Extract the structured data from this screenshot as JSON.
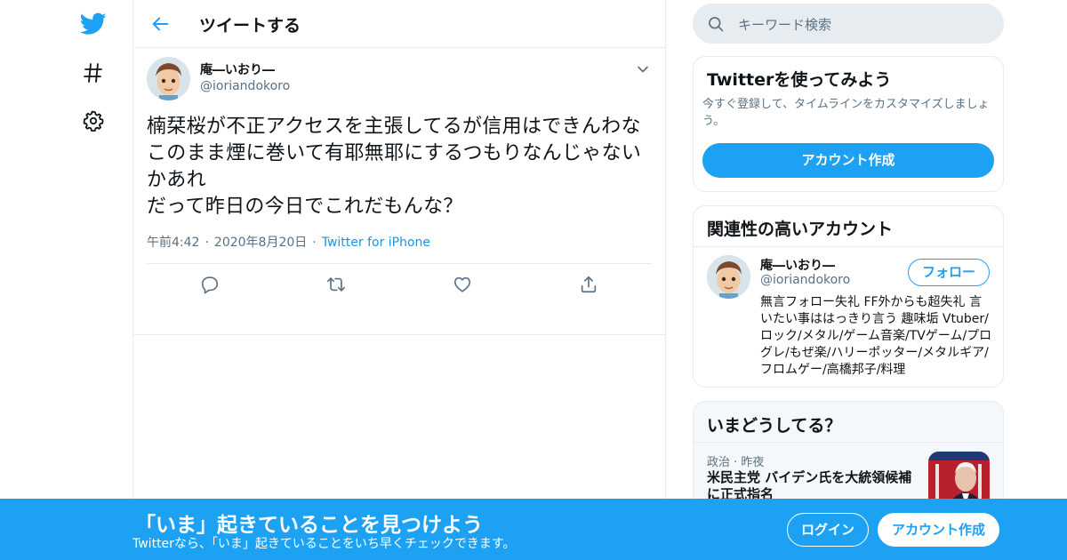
{
  "colors": {
    "accent": "#1da1f2",
    "muted": "#5b7083",
    "border": "#e6ecf0",
    "banner": "#1da1f2"
  },
  "nav": {
    "items": [
      {
        "icon": "twitter-bird-icon"
      },
      {
        "icon": "hashtag-icon"
      },
      {
        "icon": "gear-icon"
      }
    ]
  },
  "header": {
    "title": "ツイートする",
    "back_icon": "back-arrow-icon"
  },
  "tweet": {
    "author_name": "庵―いおり―",
    "author_handle": "@ioriandokoro",
    "text": "楠栞桜が不正アクセスを主張してるが信用はできんわな\nこのまま煙に巻いて有耶無耶にするつもりなんじゃないかあれ\nだって昨日の今日でこれだもんな？",
    "time": "午前4:42",
    "date": "2020年8月20日",
    "source": "Twitter for iPhone",
    "actions": [
      "reply-icon",
      "retweet-icon",
      "like-icon",
      "share-icon"
    ]
  },
  "search": {
    "placeholder": "キーワード検索"
  },
  "signup_card": {
    "title": "Twitterを使ってみよう",
    "description": "今すぐ登録して、タイムラインをカスタマイズしましょう。",
    "button": "アカウント作成"
  },
  "related": {
    "title": "関連性の高いアカウント",
    "name": "庵―いおり―",
    "handle": "@ioriandokoro",
    "follow": "フォロー",
    "bio": "無言フォロー失礼 FF外からも超失礼 言いたい事ははっきり言う 趣味垢 Vtuber/ロック/メタル/ゲーム音楽/TVゲーム/プログレ/もぜ楽/ハリーポッター/メタルギア/フロムゲー/高橋邦子/料理"
  },
  "trends": {
    "title": "いまどうしてる？",
    "category": "政治",
    "time": "昨夜",
    "headline": "米民主党 バイデン氏を大統領候補に正式指名"
  },
  "banner": {
    "title": "「いま」起きていることを見つけよう",
    "subtitle": "Twitterなら、「いま」起きていることをいち早くチェックできます。",
    "login": "ログイン",
    "signup": "アカウント作成"
  }
}
